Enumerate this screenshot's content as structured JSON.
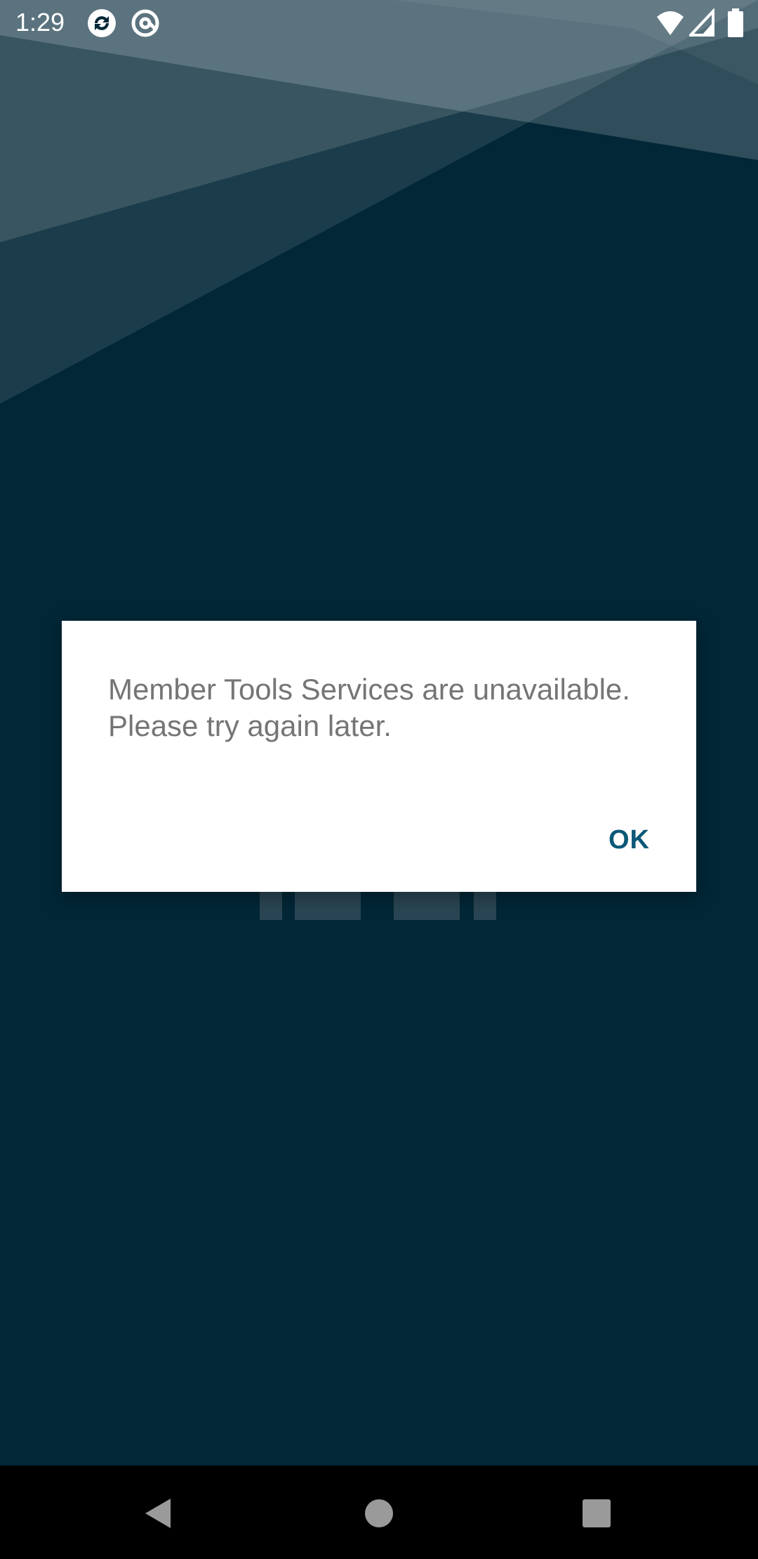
{
  "status_bar": {
    "time": "1:29",
    "icons": [
      "sync-icon",
      "at-sign-icon",
      "wifi-icon",
      "cellular-signal-icon",
      "battery-icon"
    ]
  },
  "dialog": {
    "message": "Member Tools Services are unavailable. Please try again later.",
    "ok_label": "OK"
  },
  "nav_bar": {
    "buttons": [
      "back-button",
      "home-button",
      "recents-button"
    ]
  },
  "colors": {
    "background": "#022737",
    "dialog_bg": "#ffffff",
    "dialog_text": "#757575",
    "accent": "#0b5877",
    "nav_bar": "#000000"
  }
}
